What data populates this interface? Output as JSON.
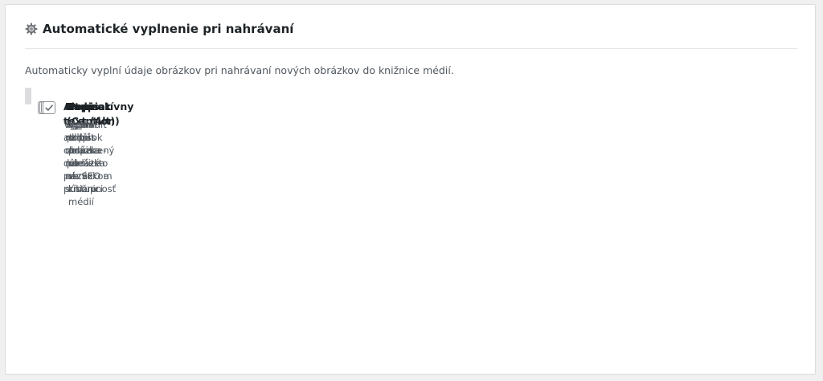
{
  "section": {
    "title": "Automatické vyplnenie pri nahrávaní",
    "icon": "gear-icon",
    "description": "Automaticky vyplní údaje obrázkov pri nahrávaní nových obrázkov do knižnice médií."
  },
  "options": [
    {
      "title": "Alternatívny text (Alt)",
      "description": "Vyplní alt atribút obrázka - dôležité pre SEO a prístupnosť",
      "checked": true
    },
    {
      "title": "Nadpis",
      "description": "Vyplní nadpis obrázka namiesto názvu súboru",
      "checked": true
    },
    {
      "title": "Popisok (Caption)",
      "description": "Vyplní popisok zobrazený pod obrázkom",
      "checked": true
    },
    {
      "title": "Popis",
      "description": "Vyplní dlhší popis obrázka v knižnici médií",
      "checked": true
    }
  ],
  "colors": {
    "panel_bg": "#ffffff",
    "page_bg": "#f0f0f1",
    "option_bg": "#f6f7f7",
    "border": "#dcdcde",
    "text": "#1d2327",
    "muted": "#50575e",
    "check": "#646970"
  }
}
